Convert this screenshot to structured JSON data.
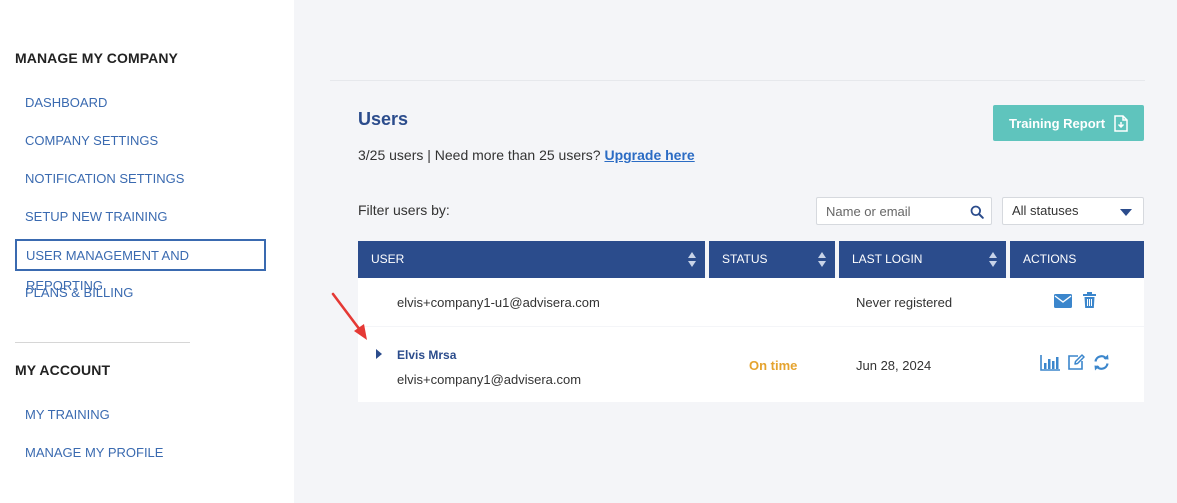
{
  "sidebar": {
    "section1_title": "MANAGE MY COMPANY",
    "company_items": [
      {
        "label": "DASHBOARD"
      },
      {
        "label": "COMPANY SETTINGS"
      },
      {
        "label": "NOTIFICATION SETTINGS"
      },
      {
        "label": "SETUP NEW TRAINING"
      },
      {
        "label": "USER MANAGEMENT AND REPORTING",
        "active": true
      },
      {
        "label": "PLANS & BILLING"
      }
    ],
    "section2_title": "MY ACCOUNT",
    "account_items": [
      {
        "label": "MY TRAINING"
      },
      {
        "label": "MANAGE MY PROFILE"
      }
    ]
  },
  "main": {
    "title": "Users",
    "users_count_text": "3/25 users | Need more than 25 users? ",
    "upgrade_link": "Upgrade here",
    "training_report_button": "Training Report",
    "filter_label": "Filter users by:",
    "search_placeholder": "Name or email",
    "status_filter_value": "All statuses"
  },
  "table": {
    "columns": [
      "USER",
      "STATUS",
      "LAST LOGIN",
      "ACTIONS"
    ],
    "rows": [
      {
        "name": "",
        "email": "elvis+company1-u1@advisera.com",
        "status": "",
        "last_login": "Never registered",
        "actions": [
          "envelope-icon",
          "trash-icon"
        ]
      },
      {
        "name": "Elvis Mrsa",
        "email": "elvis+company1@advisera.com",
        "status": "On time",
        "last_login": "Jun 28, 2024",
        "actions": [
          "bar-chart-icon",
          "edit-icon",
          "refresh-icon"
        ]
      }
    ]
  },
  "colors": {
    "brand": "#2b4c8c",
    "link": "#3a6ab0",
    "report_button": "#5fc4bd",
    "status_on_time": "#e5a32e",
    "action_icons": "#3b86cc",
    "annotation_arrow": "#e53935"
  }
}
